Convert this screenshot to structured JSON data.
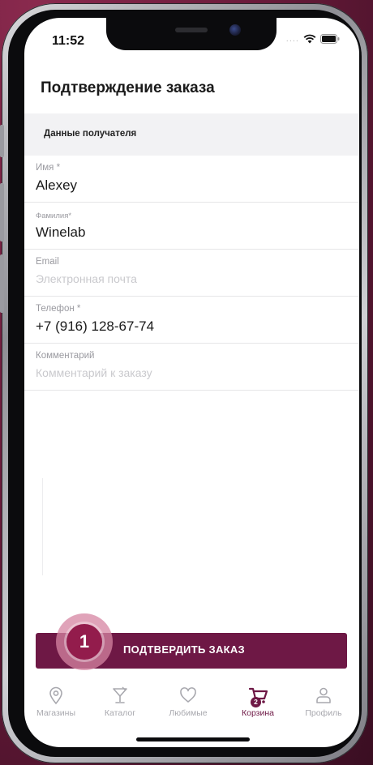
{
  "status_bar": {
    "time": "11:52"
  },
  "page": {
    "title": "Подтверждение заказа"
  },
  "section": {
    "title": "Данные получателя"
  },
  "fields": [
    {
      "label": "Имя *",
      "value": "Alexey",
      "placeholder": ""
    },
    {
      "label": "Фамилия*",
      "value": "Winelab",
      "placeholder": ""
    },
    {
      "label": "Email",
      "value": "",
      "placeholder": "Электронная почта"
    },
    {
      "label": "Телефон *",
      "value": "+7 (916) 128-67-74",
      "placeholder": ""
    },
    {
      "label": "Комментарий",
      "value": "",
      "placeholder": "Комментарий к заказу"
    }
  ],
  "confirm_button": {
    "label": "ПОДТВЕРДИТЬ ЗАКАЗ"
  },
  "step_marker": {
    "number": "1"
  },
  "tabbar": {
    "items": [
      {
        "label": "Магазины",
        "icon": "location-pin-icon",
        "active": false
      },
      {
        "label": "Каталог",
        "icon": "cocktail-glass-icon",
        "active": false
      },
      {
        "label": "Любимые",
        "icon": "heart-icon",
        "active": false
      },
      {
        "label": "Корзина",
        "icon": "cart-icon",
        "active": true,
        "badge": "2"
      },
      {
        "label": "Профиль",
        "icon": "person-icon",
        "active": false
      }
    ]
  },
  "colors": {
    "brand": "#6e1845",
    "step_marker": "#931c4c",
    "background": "#6b1b3b"
  }
}
